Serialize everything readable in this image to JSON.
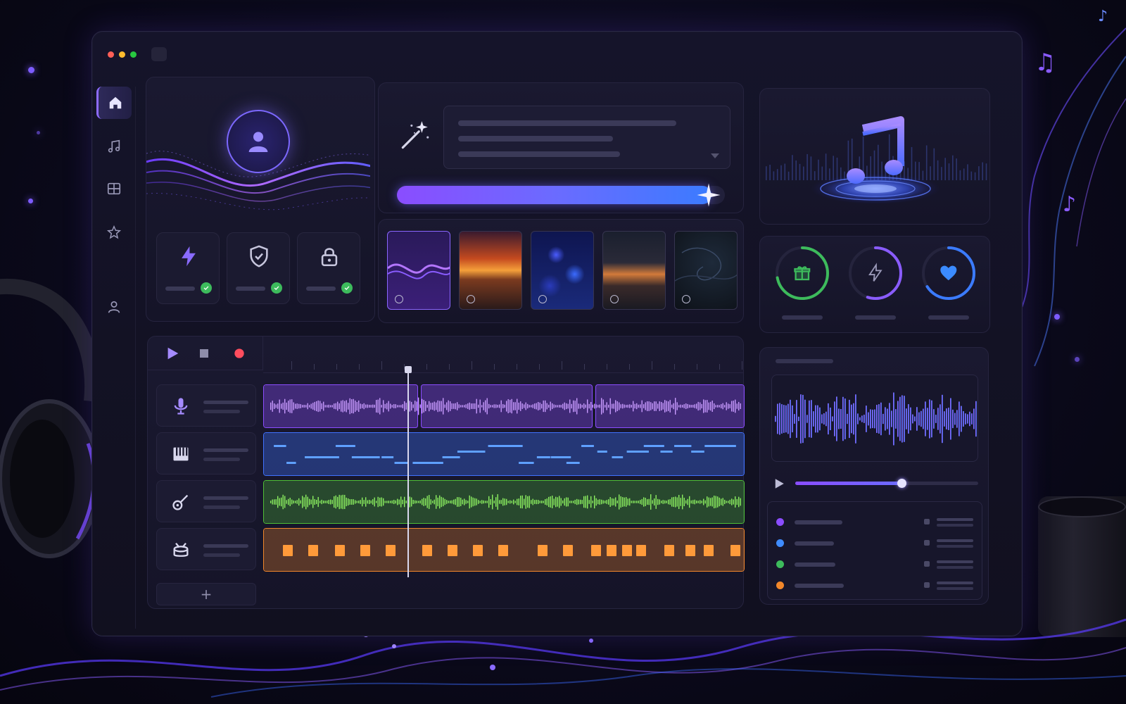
{
  "window": {
    "controls": [
      "close",
      "minimize",
      "maximize"
    ]
  },
  "sidebar": {
    "items": [
      {
        "icon": "home-icon",
        "active": true
      },
      {
        "icon": "music-note-icon",
        "active": false
      },
      {
        "icon": "grid-icon",
        "active": false
      },
      {
        "icon": "star-icon",
        "active": false
      },
      {
        "icon": "user-icon",
        "active": false
      }
    ]
  },
  "profile": {
    "avatar_icon": "user-icon",
    "features": [
      {
        "icon": "lightning-icon",
        "status": "enabled"
      },
      {
        "icon": "shield-check-icon",
        "status": "enabled"
      },
      {
        "icon": "lock-icon",
        "status": "enabled"
      }
    ]
  },
  "generator": {
    "icon": "magic-wand-icon",
    "progress": 0.96
  },
  "styles": {
    "thumbnails": [
      "purple-wave",
      "sunset",
      "bokeh",
      "city-rain",
      "dark-swirl"
    ],
    "selected_index": 0
  },
  "stats": {
    "rings": [
      {
        "icon": "gift-icon",
        "value": 0.72,
        "color": "#3dbb5c"
      },
      {
        "icon": "lightning-icon",
        "value": 0.55,
        "color": "#8a5cff"
      },
      {
        "icon": "heart-icon",
        "value": 0.66,
        "color": "#3b7bff"
      }
    ]
  },
  "daw": {
    "transport": [
      "play",
      "stop",
      "record"
    ],
    "tracks": [
      {
        "icon": "microphone-icon",
        "color": "#8b4dff"
      },
      {
        "icon": "piano-icon",
        "color": "#3f72ff"
      },
      {
        "icon": "guitar-icon",
        "color": "#4fbf36"
      },
      {
        "icon": "drums-icon",
        "color": "#f2872a"
      }
    ],
    "add_label": "+",
    "playhead_position": 0.3
  },
  "preview": {
    "playback_progress": 0.58,
    "layers": [
      {
        "color": "#8b4dff"
      },
      {
        "color": "#3f8cff"
      },
      {
        "color": "#3dbb5c"
      },
      {
        "color": "#f2872a"
      }
    ]
  },
  "colors": {
    "accent": "#8a5cff",
    "accent_blue": "#3b7bff",
    "success": "#3dbb5c",
    "warning": "#f2872a"
  }
}
